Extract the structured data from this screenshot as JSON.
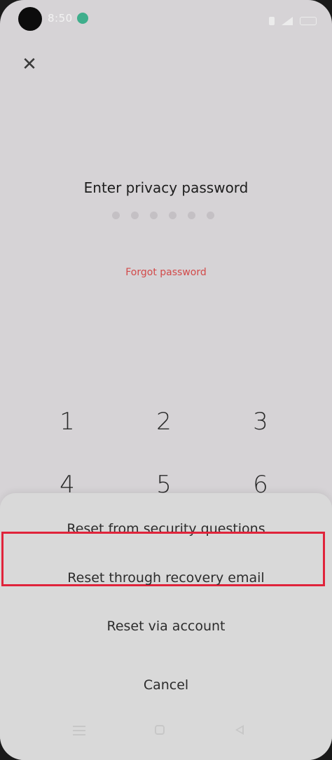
{
  "status_bar": {
    "time": "8:50",
    "icons": [
      "camera-hole",
      "phone-call-icon",
      "vibrate-icon",
      "signal-icon",
      "battery-icon"
    ]
  },
  "header": {
    "close_icon": "close-icon",
    "close_glyph": "✕"
  },
  "lock": {
    "title": "Enter privacy password",
    "dot_count": 6,
    "forgot_label": "Forgot password"
  },
  "keypad": {
    "keys": [
      "1",
      "2",
      "3",
      "4",
      "5",
      "6"
    ]
  },
  "sheet": {
    "options": [
      "Reset from security questions",
      "Reset through recovery email",
      "Reset via account"
    ],
    "cancel_label": "Cancel",
    "highlighted_option_index": 1,
    "highlight_color": "#e0243b"
  },
  "nav_bar": {
    "icons": [
      "menu-icon",
      "home-icon",
      "back-icon"
    ]
  }
}
